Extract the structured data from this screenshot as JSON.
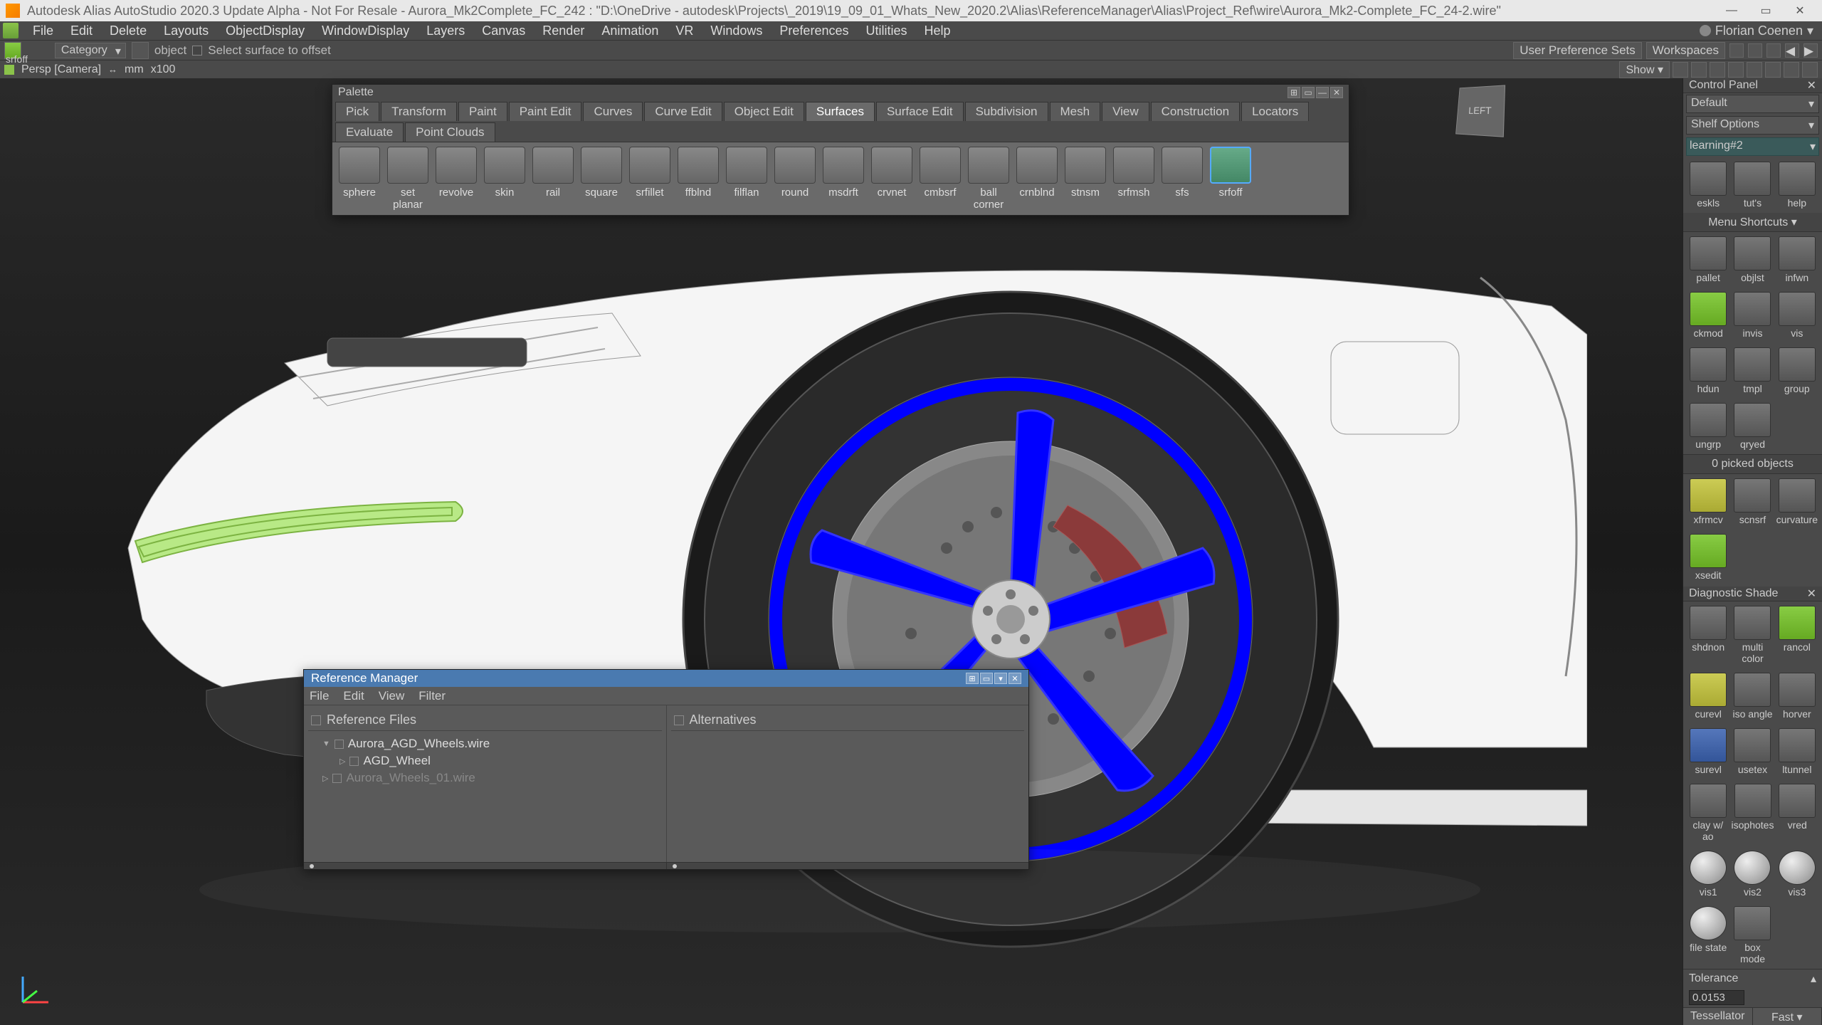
{
  "titlebar": {
    "text": "Autodesk Alias AutoStudio 2020.3 Update Alpha - Not For Resale  -  Aurora_Mk2Complete_FC_242 : \"D:\\OneDrive - autodesk\\Projects\\_2019\\19_09_01_Whats_New_2020.2\\Alias\\ReferenceManager\\Alias\\Project_Ref\\wire\\Aurora_Mk2-Complete_FC_24-2.wire\""
  },
  "menubar": {
    "items": [
      "File",
      "Edit",
      "Delete",
      "Layouts",
      "ObjectDisplay",
      "WindowDisplay",
      "Layers",
      "Canvas",
      "Render",
      "Animation",
      "VR",
      "Windows",
      "Preferences",
      "Utilities",
      "Help"
    ],
    "user": "Florian Coenen",
    "pref_sets": "User Preference Sets",
    "workspaces": "Workspaces"
  },
  "toolbar": {
    "tool_active": "srfoff",
    "category_label": "Category",
    "object_label": "object",
    "surface_prompt": "Select surface to offset",
    "persp": "Persp [Camera]",
    "mm": "mm",
    "x100": "x100",
    "show": "Show"
  },
  "palette": {
    "title": "Palette",
    "tabs": [
      "Pick",
      "Transform",
      "Paint",
      "Paint Edit",
      "Curves",
      "Curve Edit",
      "Object Edit",
      "Surfaces",
      "Surface Edit",
      "Subdivision",
      "Mesh",
      "View",
      "Construction",
      "Locators",
      "Evaluate",
      "Point Clouds"
    ],
    "active_tab": "Surfaces",
    "tools": [
      {
        "label": "sphere"
      },
      {
        "label": "set planar"
      },
      {
        "label": "revolve"
      },
      {
        "label": "skin"
      },
      {
        "label": "rail"
      },
      {
        "label": "square"
      },
      {
        "label": "srfillet"
      },
      {
        "label": "ffblnd"
      },
      {
        "label": "filflan"
      },
      {
        "label": "round"
      },
      {
        "label": "msdrft"
      },
      {
        "label": "crvnet"
      },
      {
        "label": "cmbsrf"
      },
      {
        "label": "ball corner"
      },
      {
        "label": "crnblnd"
      },
      {
        "label": "stnsm"
      },
      {
        "label": "srfmsh"
      },
      {
        "label": "sfs"
      },
      {
        "label": "srfoff",
        "selected": true
      }
    ]
  },
  "refmgr": {
    "title": "Reference Manager",
    "menu": [
      "File",
      "Edit",
      "View",
      "Filter"
    ],
    "col1": "Reference Files",
    "col2": "Alternatives",
    "items": [
      {
        "label": "Aurora_AGD_Wheels.wire",
        "expanded": true
      },
      {
        "label": "AGD_Wheel",
        "child": true
      },
      {
        "label": "Aurora_Wheels_01.wire",
        "dim": true
      }
    ]
  },
  "ctrlpanel": {
    "title": "Control Panel",
    "default": "Default",
    "shelf_options": "Shelf Options",
    "shelf": "learning#2",
    "row1": [
      {
        "l": "eskls"
      },
      {
        "l": "tut's"
      },
      {
        "l": "help"
      }
    ],
    "menu_shortcuts": "Menu Shortcuts",
    "msrows": [
      [
        {
          "l": "pallet"
        },
        {
          "l": "objlst"
        },
        {
          "l": "infwn"
        }
      ],
      [
        {
          "l": "ckmod",
          "c": "hl"
        },
        {
          "l": "invis"
        },
        {
          "l": "vis"
        }
      ],
      [
        {
          "l": "hdun"
        },
        {
          "l": "tmpl"
        },
        {
          "l": "group"
        }
      ],
      [
        {
          "l": "ungrp"
        },
        {
          "l": "qryed"
        }
      ]
    ],
    "picked": "0 picked objects",
    "xform": [
      [
        {
          "l": "xfrmcv",
          "c": "ylw"
        },
        {
          "l": "scnsrf"
        },
        {
          "l": "curvature"
        }
      ],
      [
        {
          "l": "xsedit",
          "c": "hl"
        }
      ]
    ],
    "diag_title": "Diagnostic Shade",
    "diag": [
      [
        {
          "l": "shdnon"
        },
        {
          "l": "multi color"
        },
        {
          "l": "rancol",
          "c": "hl"
        }
      ],
      [
        {
          "l": "curevl",
          "c": "ylw"
        },
        {
          "l": "iso angle"
        },
        {
          "l": "horver"
        }
      ],
      [
        {
          "l": "surevl",
          "c": "blue"
        },
        {
          "l": "usetex"
        },
        {
          "l": "ltunnel"
        }
      ],
      [
        {
          "l": "clay w/ ao"
        },
        {
          "l": "isophotes"
        },
        {
          "l": "vred"
        }
      ],
      [
        {
          "l": "vis1",
          "c": "sph"
        },
        {
          "l": "vis2",
          "c": "sph"
        },
        {
          "l": "vis3",
          "c": "sph"
        }
      ],
      [
        {
          "l": "file state",
          "c": "sph"
        },
        {
          "l": "box mode"
        }
      ]
    ],
    "tolerance_label": "Tolerance",
    "tolerance_value": "0.0153",
    "bottom": [
      "Tessellator",
      "Fast"
    ]
  },
  "viewcube": "LEFT"
}
